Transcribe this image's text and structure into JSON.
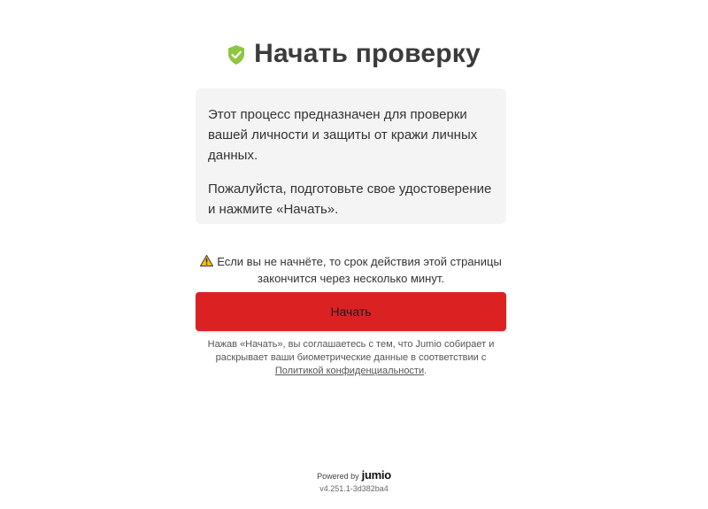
{
  "header": {
    "title": "Начать проверку",
    "icon": "shield-check-icon",
    "icon_color": "#8dc63f"
  },
  "info": {
    "paragraph_1": "Этот процесс предназначен для проверки вашей личности и защиты от кражи личных данных.",
    "paragraph_2": "Пожалуйста, подготовьте свое удостоверение и нажмите «Начать»."
  },
  "warning": {
    "icon": "warning-triangle-icon",
    "text": "Если вы не начнёте, то срок действия этой страницы закончится через несколько минут."
  },
  "start_button": {
    "label": "Начать",
    "color": "#dc2123"
  },
  "consent": {
    "text": "Нажав «Начать», вы соглашаетесь с тем, что Jumio собирает и раскрывает ваши биометрические данные в соответствии с",
    "link_label": "Политикой конфиденциальности",
    "suffix": "."
  },
  "footer": {
    "powered_by": "Powered by",
    "brand": "jumio",
    "version": "v4.251.1-3d382ba4"
  }
}
